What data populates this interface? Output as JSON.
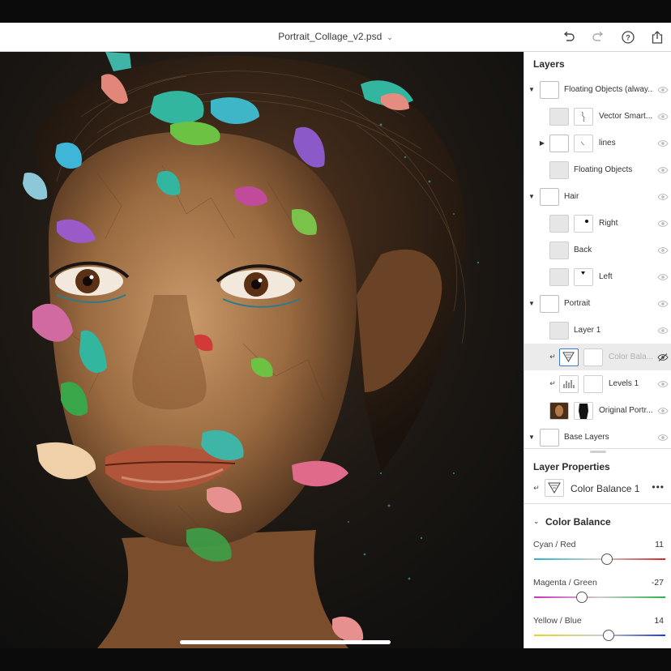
{
  "window": {
    "title": "Portrait_Collage_v2.psd"
  },
  "toolbar": {
    "icons": [
      "undo-icon",
      "redo-icon",
      "help-icon",
      "share-icon"
    ]
  },
  "layers_panel": {
    "title": "Layers",
    "rows": [
      {
        "name": "Floating Objects (alway...",
        "kind": "group",
        "expanded": true,
        "visible": true
      },
      {
        "name": "Vector Smart...",
        "kind": "layer",
        "visible": true
      },
      {
        "name": "lines",
        "kind": "group",
        "expanded": false,
        "visible": true
      },
      {
        "name": "Floating Objects",
        "kind": "layer",
        "visible": true
      },
      {
        "name": "Hair",
        "kind": "group",
        "expanded": true,
        "visible": true
      },
      {
        "name": "Right",
        "kind": "layer",
        "visible": true
      },
      {
        "name": "Back",
        "kind": "layer",
        "visible": true
      },
      {
        "name": "Left",
        "kind": "layer",
        "visible": true
      },
      {
        "name": "Portrait",
        "kind": "group",
        "expanded": true,
        "visible": true
      },
      {
        "name": "Layer 1",
        "kind": "layer",
        "visible": true
      },
      {
        "name": "Color Bala...",
        "kind": "adjustment",
        "selected": true,
        "visible": false
      },
      {
        "name": "Levels 1",
        "kind": "adjustment",
        "visible": true
      },
      {
        "name": "Original Portr...",
        "kind": "layer",
        "visible": true
      },
      {
        "name": "Base Layers",
        "kind": "group",
        "expanded": true,
        "visible": true
      }
    ]
  },
  "layer_properties": {
    "title": "Layer Properties",
    "layer_name": "Color Balance 1",
    "more": "•••",
    "section": "Color Balance",
    "sliders": [
      {
        "label": "Cyan / Red",
        "value": "11",
        "fraction": 0.555,
        "from": "#2ab7c9",
        "to": "#d9262a"
      },
      {
        "label": "Magenta / Green",
        "value": "-27",
        "fraction": 0.365,
        "from": "#d12fc0",
        "to": "#2fb34a"
      },
      {
        "label": "Yellow / Blue",
        "value": "14",
        "fraction": 0.57,
        "from": "#e7d51c",
        "to": "#1f3bd6"
      }
    ]
  }
}
